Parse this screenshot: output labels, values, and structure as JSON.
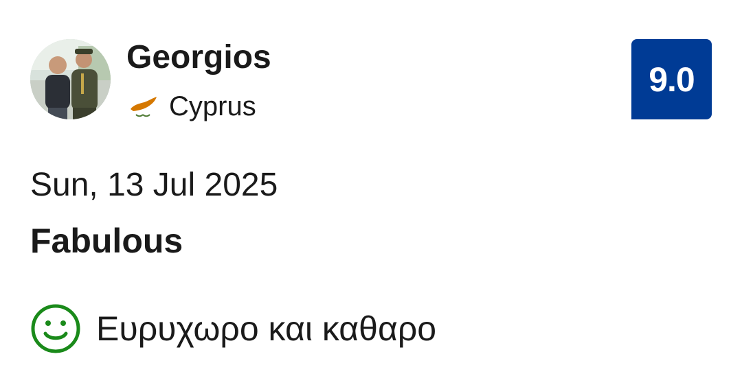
{
  "reviewer": {
    "name": "Georgios",
    "country": "Cyprus",
    "avatar_icon": "user-photo",
    "flag_icon": "cyprus-flag-icon"
  },
  "score": {
    "value": "9.0",
    "badge_color": "#003b95"
  },
  "review": {
    "date": "Sun, 13 Jul 2025",
    "title": "Fabulous",
    "positive_text": "Ευρυχωρο και καθαρο",
    "positive_icon": "smiley-icon",
    "positive_color": "#1a8a1a"
  }
}
